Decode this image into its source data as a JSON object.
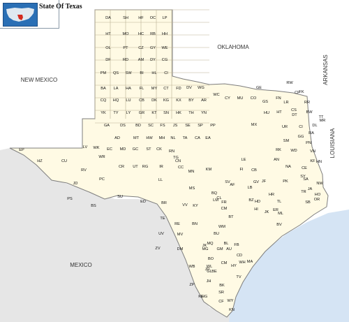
{
  "map": {
    "title": "State Of Texas",
    "colors": {
      "land": "#fffae4",
      "outside": "#eaeaea",
      "water": "#dbe8f6",
      "border": "#8a8a8a",
      "county_line": "#b9b092"
    }
  },
  "regions": {
    "new_mexico": "NEW MEXICO",
    "oklahoma": "OKLAHOMA",
    "arkansas": "ARKANSAS",
    "louisiana": "LOUISIANA",
    "mexico": "MEXICO"
  },
  "counties": [
    "DA",
    "SH",
    "HF",
    "OC",
    "LP",
    "HT",
    "MO",
    "HC",
    "RB",
    "HH",
    "OL",
    "PT",
    "CZ",
    "GY",
    "WE",
    "DF",
    "RD",
    "AM",
    "DY",
    "CG",
    "PM",
    "QS",
    "SW",
    "BI",
    "HL",
    "CI",
    "BA",
    "LA",
    "HA",
    "FL",
    "MY",
    "CT",
    "FD",
    "CQ",
    "HQ",
    "LU",
    "CB",
    "DK",
    "KG",
    "KX",
    "BY",
    "AR",
    "YK",
    "TY",
    "LY",
    "GR",
    "KT",
    "SN",
    "HK",
    "TH",
    "YN",
    "GA",
    "DS",
    "BD",
    "SC",
    "FS",
    "JS",
    "SE",
    "SP",
    "PP",
    "AD",
    "MT",
    "HW",
    "MH",
    "NL",
    "TA",
    "CA",
    "EA",
    "EP",
    "HZ",
    "CU",
    "RV",
    "JD",
    "PS",
    "BS",
    "PC",
    "LV",
    "WK",
    "EC",
    "MD",
    "GC",
    "ST",
    "CK",
    "RN",
    "WR",
    "CR",
    "UT",
    "RG",
    "IR",
    "TG",
    "CC",
    "CN",
    "MN",
    "KM",
    "MS",
    "LL",
    "BR",
    "SU",
    "ED",
    "TE",
    "VV",
    "KY",
    "RE",
    "BN",
    "UV",
    "MV",
    "ZV",
    "DM",
    "WB",
    "JD",
    "ZP",
    "SR",
    "HG",
    "CF",
    "WY",
    "KN",
    "BK",
    "JH",
    "DV",
    "WG",
    "WC",
    "CY",
    "MU",
    "CO",
    "GS",
    "FN",
    "LR",
    "RR",
    "BW",
    "CS",
    "TT",
    "MR",
    "CP",
    "GE",
    "RW",
    "FK",
    "MX",
    "HU",
    "HT",
    "DT",
    "CI",
    "DL",
    "RA",
    "UR",
    "GG",
    "PN",
    "SM",
    "RK",
    "WD",
    "KF",
    "VN",
    "HN",
    "AN",
    "CE",
    "NA",
    "SY",
    "SA",
    "JA",
    "NW",
    "HO",
    "SB",
    "OR",
    "TR",
    "PK",
    "TL",
    "HR",
    "JF",
    "CB",
    "GV",
    "LB",
    "LE",
    "FI",
    "AF",
    "BZ",
    "ER",
    "JK",
    "ML",
    "BV",
    "HD",
    "HI",
    "SV",
    "FR",
    "CL",
    "BQ",
    "LM",
    "CM",
    "BT",
    "WM",
    "BU",
    "BL",
    "GM",
    "MG",
    "MQ",
    "FB",
    "WL",
    "AU",
    "CD",
    "BO",
    "WH",
    "MA",
    "JK",
    "GL",
    "KE",
    "BE",
    "CM",
    "HY",
    "TV",
    "BP",
    "FY",
    "WA",
    "DE",
    "GZ",
    "CV",
    "GU",
    "SN",
    "WN",
    "KA",
    "LC",
    "ZV",
    "AT",
    "MC",
    "FR",
    "LS",
    "MC",
    "DE",
    "LK",
    "BE",
    "RF",
    "SP",
    "NU",
    "KL",
    "VT",
    "CL",
    "AS",
    "DM",
    "SR",
    "HG",
    "ST",
    "DU",
    "AU",
    "GO"
  ]
}
